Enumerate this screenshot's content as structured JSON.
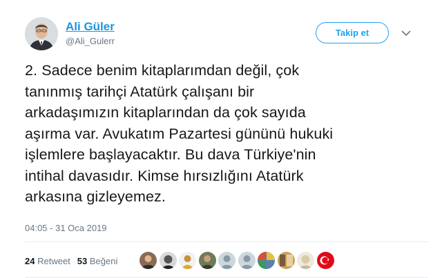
{
  "author": {
    "display_name": "Ali Güler",
    "handle": "@Ali_Gulerr"
  },
  "follow_button_label": "Takip et",
  "tweet": {
    "lines": [
      "2. Sadece benim kitaplarımdan değil, çok",
      "tanınmış tarihçi Atatürk çalışanı bir",
      "arkadaşımızın kitaplarından da çok sayıda",
      "aşırma var. Avukatım Pazartesi gününü hukuki",
      "işlemlere başlayacaktır. Bu dava Türkiye'nin",
      "intihal davasıdır. Kimse hırsızlığını Atatürk",
      "arkasına gizleyemez."
    ],
    "timestamp": "04:05 - 31 Oca 2019"
  },
  "stats": {
    "retweet_count": "24",
    "retweet_label": "Retweet",
    "like_count": "53",
    "like_label": "Beğeni"
  },
  "liker_avatars": [
    {
      "icon": "person-photo",
      "bg": "#8a6a52"
    },
    {
      "icon": "portrait-bw",
      "bg": "#3a3a3a"
    },
    {
      "icon": "person-yellow",
      "bg": "#e0a72a"
    },
    {
      "icon": "person-dark",
      "bg": "#4a4a3a"
    },
    {
      "icon": "default-avatar",
      "bg": "#9aa3ab"
    },
    {
      "icon": "default-avatar",
      "bg": "#9aa3ab"
    },
    {
      "icon": "colorful-collage",
      "bg": "#5b7fb0"
    },
    {
      "icon": "collage",
      "bg": "#c9a25a"
    },
    {
      "icon": "pale-portrait",
      "bg": "#d9d0c0"
    },
    {
      "icon": "turkish-flag",
      "bg": "#e30a17"
    }
  ],
  "colors": {
    "accent": "#1da1f2",
    "link": "#1b95e0",
    "text": "#14171a",
    "muted": "#657786"
  }
}
